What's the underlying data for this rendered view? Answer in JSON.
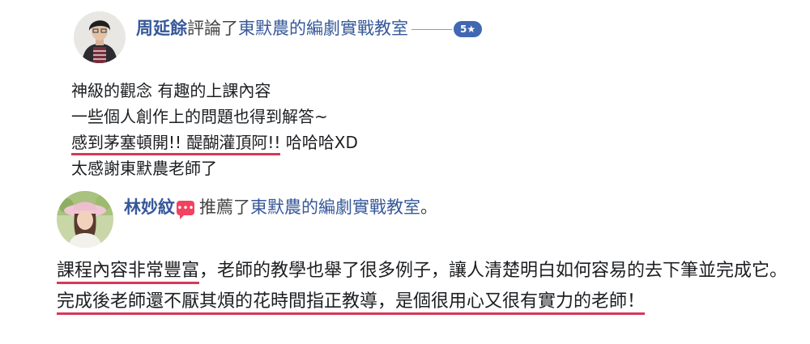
{
  "review1": {
    "reviewer_name": "周延餘",
    "action": "評論了",
    "page_name": "東默農的編劇實戰教室",
    "rating": "5★",
    "lines": [
      "神級的觀念 有趣的上課內容",
      "一些個人創作上的問題也得到解答~"
    ],
    "highlight": "感到茅塞頓開!! 醍醐灌頂阿!!",
    "after_highlight": " 哈哈哈XD",
    "last_line": "太感謝東默農老師了"
  },
  "review2": {
    "reviewer_name": "林妙紋",
    "action": "推薦了",
    "page_name": "東默農的編劇實戰教室",
    "end_mark": "。",
    "highlight_a": "課程內容非常豐富",
    "middle": "，老師的教學也舉了很多例子，讓人清楚明白如何容易的去下筆並完成它。",
    "highlight_b": "完成後老師還不厭其煩的花時間指正教導，是個很用心又很有實力的老師！"
  },
  "colors": {
    "link": "#365899",
    "badge": "#4267b2",
    "underline": "#d7385a",
    "recommend": "#f3425f"
  }
}
